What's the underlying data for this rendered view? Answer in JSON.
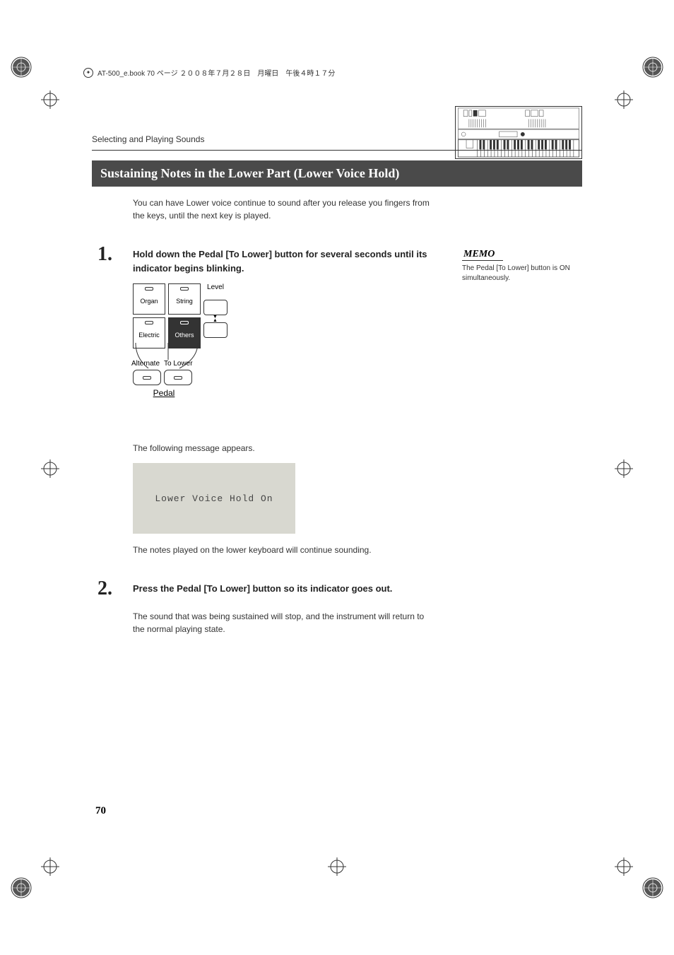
{
  "header_meta": "AT-500_e.book  70 ページ  ２００８年７月２８日　月曜日　午後４時１７分",
  "section_label": "Selecting and Playing Sounds",
  "title": "Sustaining Notes in the Lower Part (Lower Voice Hold)",
  "intro_text": "You can have Lower voice continue to sound after you release you fingers from the keys, until the next key is played.",
  "step1": {
    "number": "1.",
    "instruction": "Hold down the Pedal [To Lower] button for several seconds until its indicator begins blinking.",
    "panel": {
      "level_label": "Level",
      "btn_organ": "Organ",
      "btn_string": "String",
      "btn_electric": "Electric",
      "btn_others": "Others",
      "btn_alternate": "Alternate",
      "btn_tolower": "To Lower",
      "pedal_label": "Pedal"
    },
    "after_panel_text": "The following message appears.",
    "lcd_text": "Lower Voice Hold On",
    "after_lcd_text": "The notes played on the lower keyboard will continue sounding."
  },
  "step2": {
    "number": "2.",
    "instruction": "Press the Pedal [To Lower] button so its indicator goes out.",
    "body": "The sound that was being sustained will stop, and the instrument will return to the normal playing state."
  },
  "memo": {
    "label": "MEMO",
    "text": "The Pedal [To Lower] button is ON simultaneously."
  },
  "page_number": "70"
}
